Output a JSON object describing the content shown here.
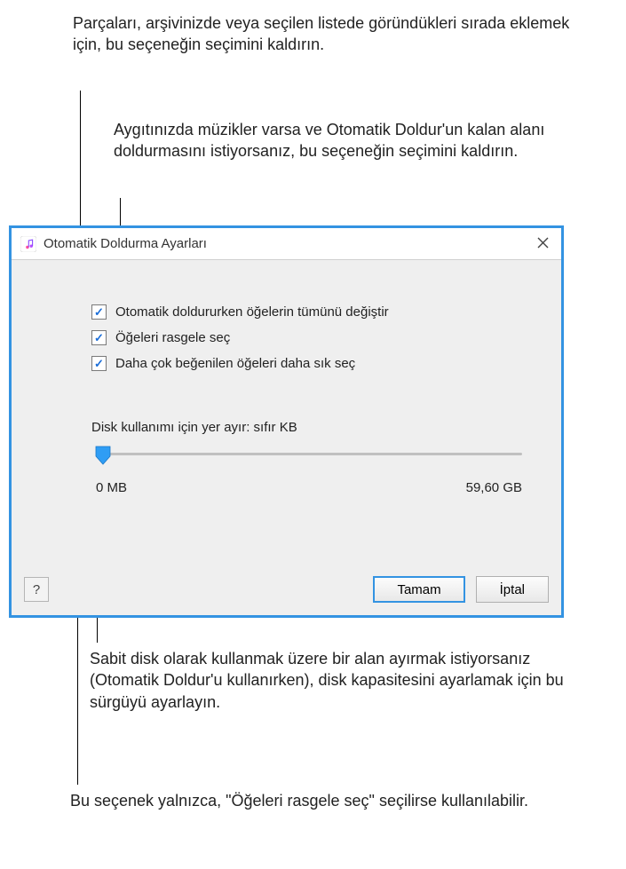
{
  "annotations": {
    "top1": "Parçaları, arşivinizde veya seçilen listede göründükleri sırada eklemek için, bu seçeneğin seçimini kaldırın.",
    "top2": "Aygıtınızda müzikler varsa ve Otomatik Doldur'un kalan alanı doldurmasını istiyorsanız, bu seçeneğin seçimini kaldırın.",
    "bottom1": "Sabit disk olarak kullanmak üzere bir alan ayırmak istiyorsanız (Otomatik Doldur'u kullanırken), disk kapasitesini ayarlamak için bu sürgüyü ayarlayın.",
    "bottom2": "Bu seçenek yalnızca, \"Öğeleri rasgele seç\" seçilirse kullanılabilir."
  },
  "dialog": {
    "title": "Otomatik Doldurma Ayarları",
    "checks": {
      "replace_all": "Otomatik doldururken öğelerin tümünü değiştir",
      "random": "Öğeleri rasgele seç",
      "higher_rated": "Daha çok beğenilen öğeleri daha sık seç"
    },
    "slider": {
      "label": "Disk kullanımı için yer ayır: sıfır KB",
      "min_label": "0 MB",
      "max_label": "59,60 GB"
    },
    "buttons": {
      "help": "?",
      "ok": "Tamam",
      "cancel": "İptal"
    }
  }
}
